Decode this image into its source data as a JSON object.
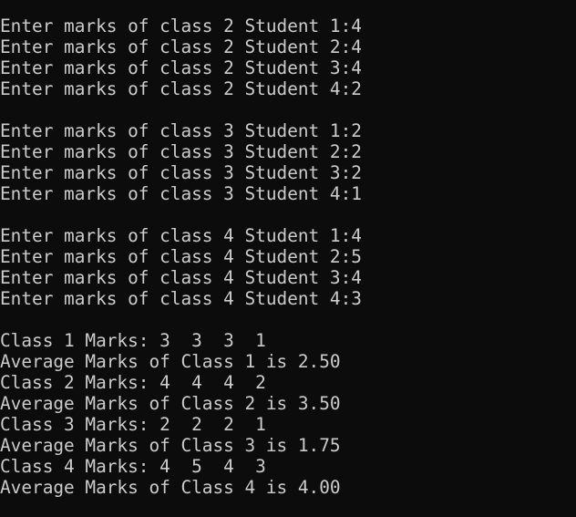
{
  "terminal": {
    "text_color": "#cccccc",
    "background_color": "#0c0c0c",
    "lines": [
      "Enter marks of class 2 Student 1:4",
      "Enter marks of class 2 Student 2:4",
      "Enter marks of class 2 Student 3:4",
      "Enter marks of class 2 Student 4:2",
      "",
      "Enter marks of class 3 Student 1:2",
      "Enter marks of class 3 Student 2:2",
      "Enter marks of class 3 Student 3:2",
      "Enter marks of class 3 Student 4:1",
      "",
      "Enter marks of class 4 Student 1:4",
      "Enter marks of class 4 Student 2:5",
      "Enter marks of class 4 Student 3:4",
      "Enter marks of class 4 Student 4:3",
      "",
      "Class 1 Marks: 3  3  3  1",
      "Average Marks of Class 1 is 2.50",
      "Class 2 Marks: 4  4  4  2",
      "Average Marks of Class 2 is 3.50",
      "Class 3 Marks: 2  2  2  1",
      "Average Marks of Class 3 is 1.75",
      "Class 4 Marks: 4  5  4  3",
      "Average Marks of Class 4 is 4.00"
    ]
  }
}
